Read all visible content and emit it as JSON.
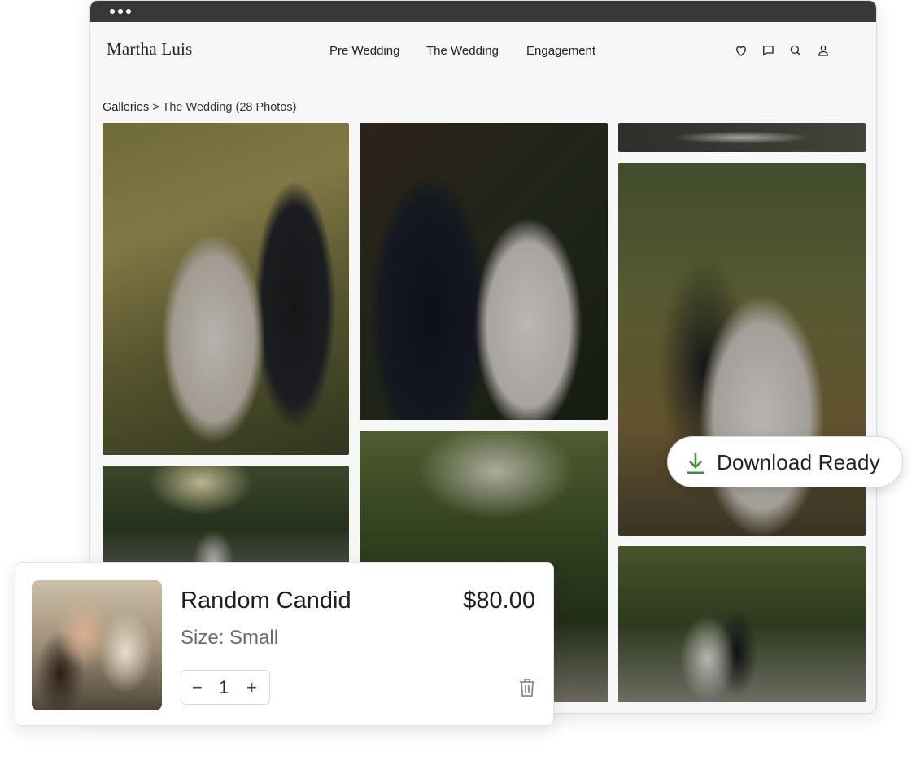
{
  "header": {
    "logo": "Martha Luis",
    "nav": [
      "Pre Wedding",
      "The Wedding",
      "Engagement"
    ],
    "icons": [
      "heart-icon",
      "chat-icon",
      "search-icon",
      "user-icon"
    ]
  },
  "breadcrumb": {
    "root": "Galleries",
    "separator": ">",
    "current": "The Wedding (28 Photos)"
  },
  "gallery": {
    "photos": [
      "bride-groom-back",
      "couple-bouquet",
      "bride-dress-top",
      "couple-embrace",
      "couple-road-wide",
      "trees-road",
      "couple-road-standing"
    ]
  },
  "download_toast": {
    "label": "Download Ready",
    "icon": "download-icon",
    "icon_color": "#3f8f3a"
  },
  "cart": {
    "title": "Random Candid",
    "price": "$80.00",
    "size": "Size: Small",
    "quantity": "1",
    "minus": "−",
    "plus": "+",
    "delete_icon": "trash-icon"
  },
  "colors": {
    "titlebar": "#383838",
    "page_bg": "#f7f7f7",
    "download_green": "#3f8f3a"
  }
}
